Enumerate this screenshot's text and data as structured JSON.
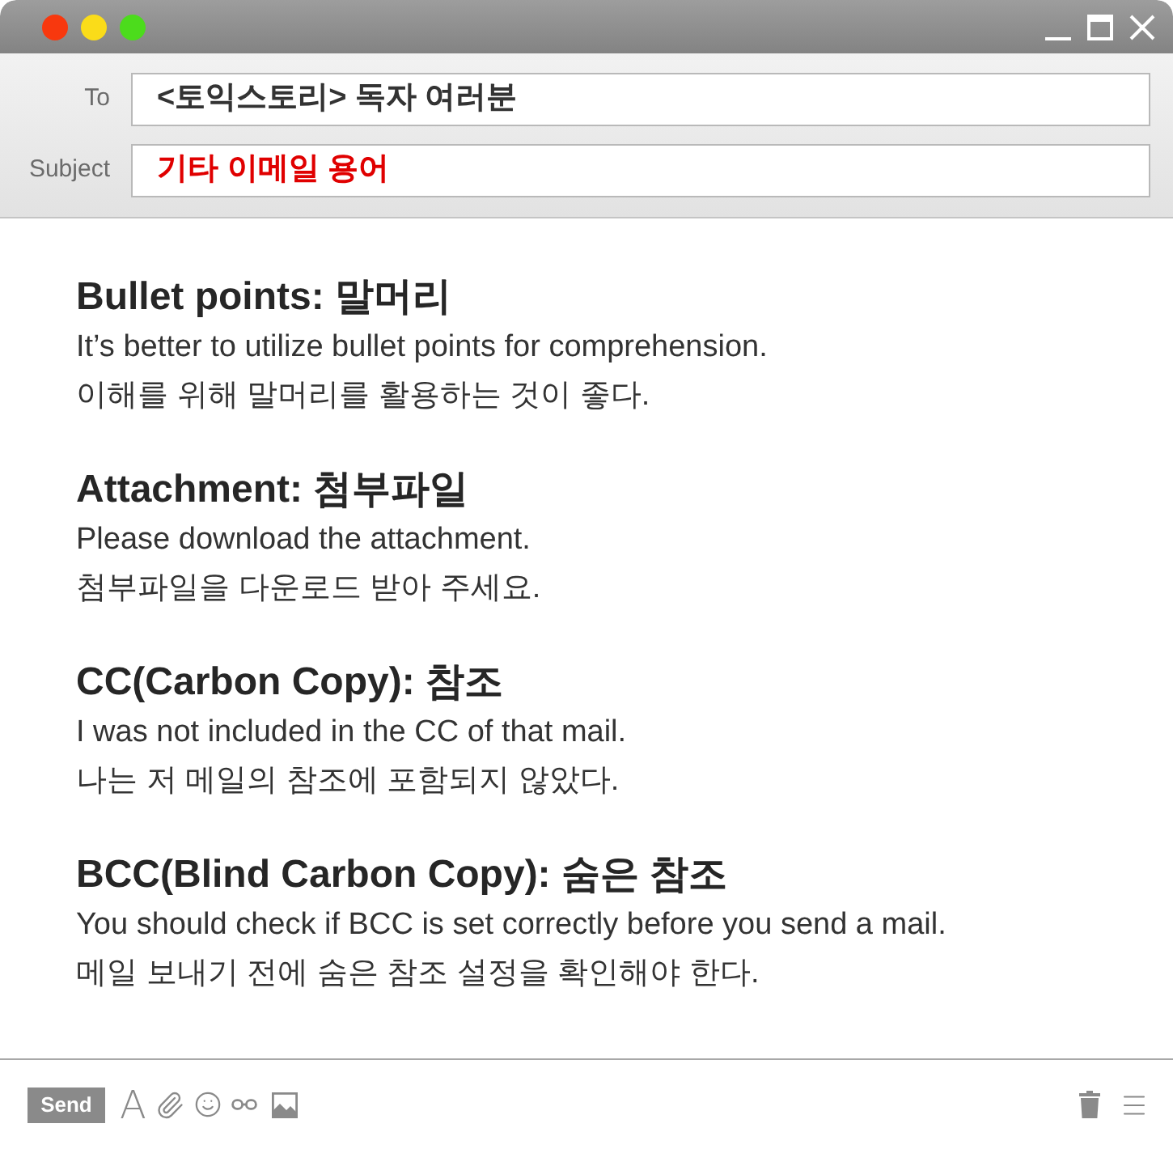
{
  "header": {
    "to": {
      "label": "To",
      "value": "<토익스토리> 독자 여러분"
    },
    "subject": {
      "label": "Subject",
      "value": "기타 이메일 용어"
    }
  },
  "sections": [
    {
      "heading": "Bullet points: 말머리",
      "lines": [
        "It’s better to utilize bullet points for comprehension.",
        "이해를 위해 말머리를 활용하는 것이 좋다."
      ]
    },
    {
      "heading": "Attachment: 첨부파일",
      "lines": [
        "Please download the attachment.",
        "첨부파일을 다운로드 받아 주세요."
      ]
    },
    {
      "heading": "CC(Carbon Copy): 참조",
      "lines": [
        "I was not included in the CC of that mail.",
        "나는 저 메일의 참조에 포함되지 않았다."
      ]
    },
    {
      "heading": "BCC(Blind Carbon Copy): 숨은 참조",
      "lines": [
        "You should check if BCC is set correctly before you send a mail.",
        "메일 보내기 전에 숨은 참조 설정을 확인해야 한다."
      ]
    }
  ],
  "toolbar": {
    "send": "Send",
    "font_button": "A"
  }
}
